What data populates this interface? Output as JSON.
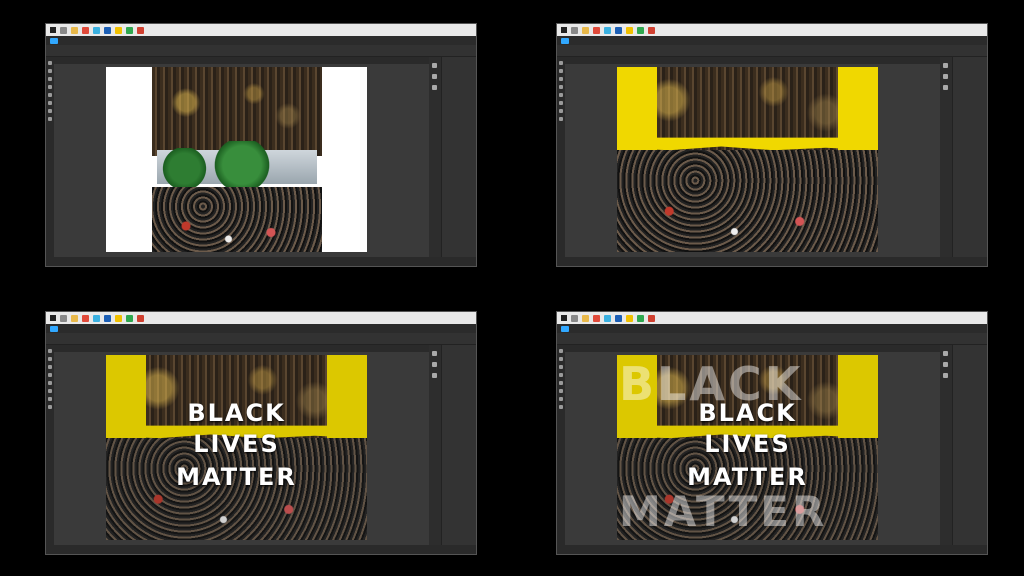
{
  "panels": [
    {
      "id": "step1",
      "step": 1
    },
    {
      "id": "step2",
      "step": 2
    },
    {
      "id": "step3",
      "step": 3
    },
    {
      "id": "step4",
      "step": 4
    }
  ],
  "poster_text": {
    "line1": "BLACK",
    "line2": "LIVES",
    "line3": "MATTER"
  },
  "ghost_text": {
    "line1": "BLACK",
    "line3": "MATTER"
  },
  "colors": {
    "accent_yellow": "#f0d800",
    "ps_bg": "#3a3a3a",
    "ps_dark": "#2b2b2b"
  },
  "icons": [
    "windows-icon",
    "search-icon",
    "folder-icon",
    "photoshop-icon",
    "chrome-icon"
  ]
}
